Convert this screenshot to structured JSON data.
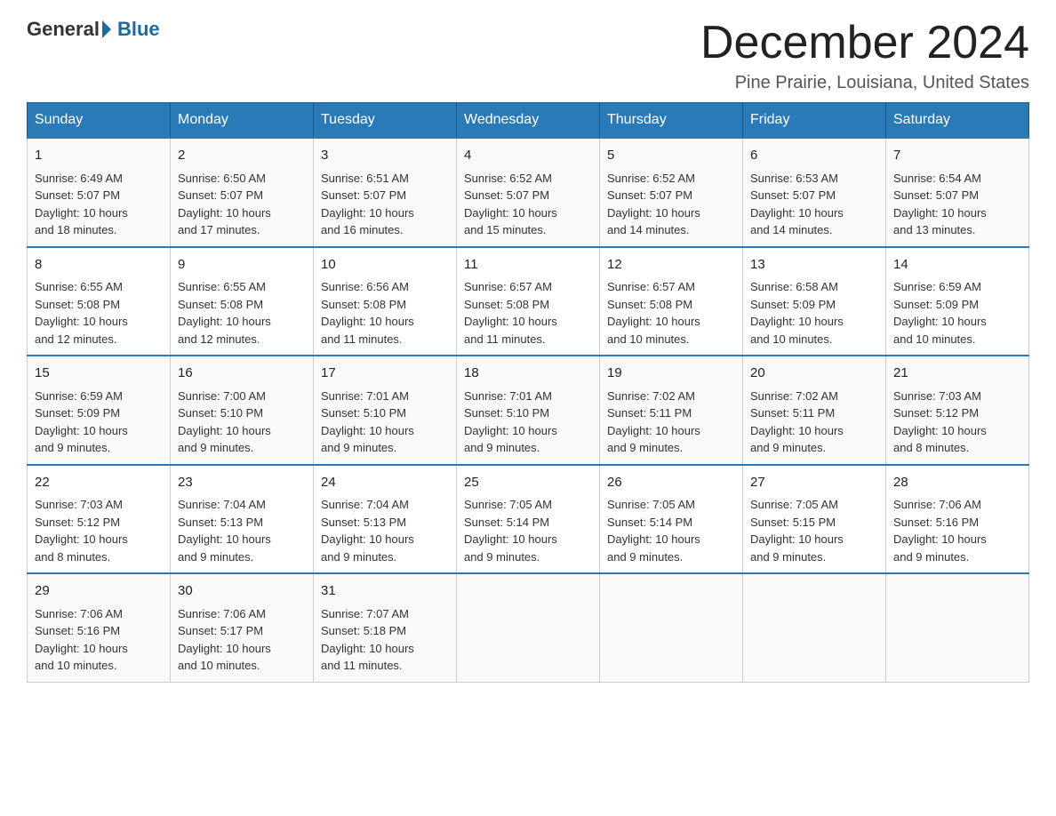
{
  "header": {
    "logo_general": "General",
    "logo_blue": "Blue",
    "month_title": "December 2024",
    "location": "Pine Prairie, Louisiana, United States"
  },
  "days_of_week": [
    "Sunday",
    "Monday",
    "Tuesday",
    "Wednesday",
    "Thursday",
    "Friday",
    "Saturday"
  ],
  "weeks": [
    [
      {
        "day": "1",
        "sunrise": "6:49 AM",
        "sunset": "5:07 PM",
        "daylight": "10 hours and 18 minutes."
      },
      {
        "day": "2",
        "sunrise": "6:50 AM",
        "sunset": "5:07 PM",
        "daylight": "10 hours and 17 minutes."
      },
      {
        "day": "3",
        "sunrise": "6:51 AM",
        "sunset": "5:07 PM",
        "daylight": "10 hours and 16 minutes."
      },
      {
        "day": "4",
        "sunrise": "6:52 AM",
        "sunset": "5:07 PM",
        "daylight": "10 hours and 15 minutes."
      },
      {
        "day": "5",
        "sunrise": "6:52 AM",
        "sunset": "5:07 PM",
        "daylight": "10 hours and 14 minutes."
      },
      {
        "day": "6",
        "sunrise": "6:53 AM",
        "sunset": "5:07 PM",
        "daylight": "10 hours and 14 minutes."
      },
      {
        "day": "7",
        "sunrise": "6:54 AM",
        "sunset": "5:07 PM",
        "daylight": "10 hours and 13 minutes."
      }
    ],
    [
      {
        "day": "8",
        "sunrise": "6:55 AM",
        "sunset": "5:08 PM",
        "daylight": "10 hours and 12 minutes."
      },
      {
        "day": "9",
        "sunrise": "6:55 AM",
        "sunset": "5:08 PM",
        "daylight": "10 hours and 12 minutes."
      },
      {
        "day": "10",
        "sunrise": "6:56 AM",
        "sunset": "5:08 PM",
        "daylight": "10 hours and 11 minutes."
      },
      {
        "day": "11",
        "sunrise": "6:57 AM",
        "sunset": "5:08 PM",
        "daylight": "10 hours and 11 minutes."
      },
      {
        "day": "12",
        "sunrise": "6:57 AM",
        "sunset": "5:08 PM",
        "daylight": "10 hours and 10 minutes."
      },
      {
        "day": "13",
        "sunrise": "6:58 AM",
        "sunset": "5:09 PM",
        "daylight": "10 hours and 10 minutes."
      },
      {
        "day": "14",
        "sunrise": "6:59 AM",
        "sunset": "5:09 PM",
        "daylight": "10 hours and 10 minutes."
      }
    ],
    [
      {
        "day": "15",
        "sunrise": "6:59 AM",
        "sunset": "5:09 PM",
        "daylight": "10 hours and 9 minutes."
      },
      {
        "day": "16",
        "sunrise": "7:00 AM",
        "sunset": "5:10 PM",
        "daylight": "10 hours and 9 minutes."
      },
      {
        "day": "17",
        "sunrise": "7:01 AM",
        "sunset": "5:10 PM",
        "daylight": "10 hours and 9 minutes."
      },
      {
        "day": "18",
        "sunrise": "7:01 AM",
        "sunset": "5:10 PM",
        "daylight": "10 hours and 9 minutes."
      },
      {
        "day": "19",
        "sunrise": "7:02 AM",
        "sunset": "5:11 PM",
        "daylight": "10 hours and 9 minutes."
      },
      {
        "day": "20",
        "sunrise": "7:02 AM",
        "sunset": "5:11 PM",
        "daylight": "10 hours and 9 minutes."
      },
      {
        "day": "21",
        "sunrise": "7:03 AM",
        "sunset": "5:12 PM",
        "daylight": "10 hours and 8 minutes."
      }
    ],
    [
      {
        "day": "22",
        "sunrise": "7:03 AM",
        "sunset": "5:12 PM",
        "daylight": "10 hours and 8 minutes."
      },
      {
        "day": "23",
        "sunrise": "7:04 AM",
        "sunset": "5:13 PM",
        "daylight": "10 hours and 9 minutes."
      },
      {
        "day": "24",
        "sunrise": "7:04 AM",
        "sunset": "5:13 PM",
        "daylight": "10 hours and 9 minutes."
      },
      {
        "day": "25",
        "sunrise": "7:05 AM",
        "sunset": "5:14 PM",
        "daylight": "10 hours and 9 minutes."
      },
      {
        "day": "26",
        "sunrise": "7:05 AM",
        "sunset": "5:14 PM",
        "daylight": "10 hours and 9 minutes."
      },
      {
        "day": "27",
        "sunrise": "7:05 AM",
        "sunset": "5:15 PM",
        "daylight": "10 hours and 9 minutes."
      },
      {
        "day": "28",
        "sunrise": "7:06 AM",
        "sunset": "5:16 PM",
        "daylight": "10 hours and 9 minutes."
      }
    ],
    [
      {
        "day": "29",
        "sunrise": "7:06 AM",
        "sunset": "5:16 PM",
        "daylight": "10 hours and 10 minutes."
      },
      {
        "day": "30",
        "sunrise": "7:06 AM",
        "sunset": "5:17 PM",
        "daylight": "10 hours and 10 minutes."
      },
      {
        "day": "31",
        "sunrise": "7:07 AM",
        "sunset": "5:18 PM",
        "daylight": "10 hours and 11 minutes."
      },
      null,
      null,
      null,
      null
    ]
  ],
  "labels": {
    "sunrise_prefix": "Sunrise: ",
    "sunset_prefix": "Sunset: ",
    "daylight_prefix": "Daylight: "
  }
}
